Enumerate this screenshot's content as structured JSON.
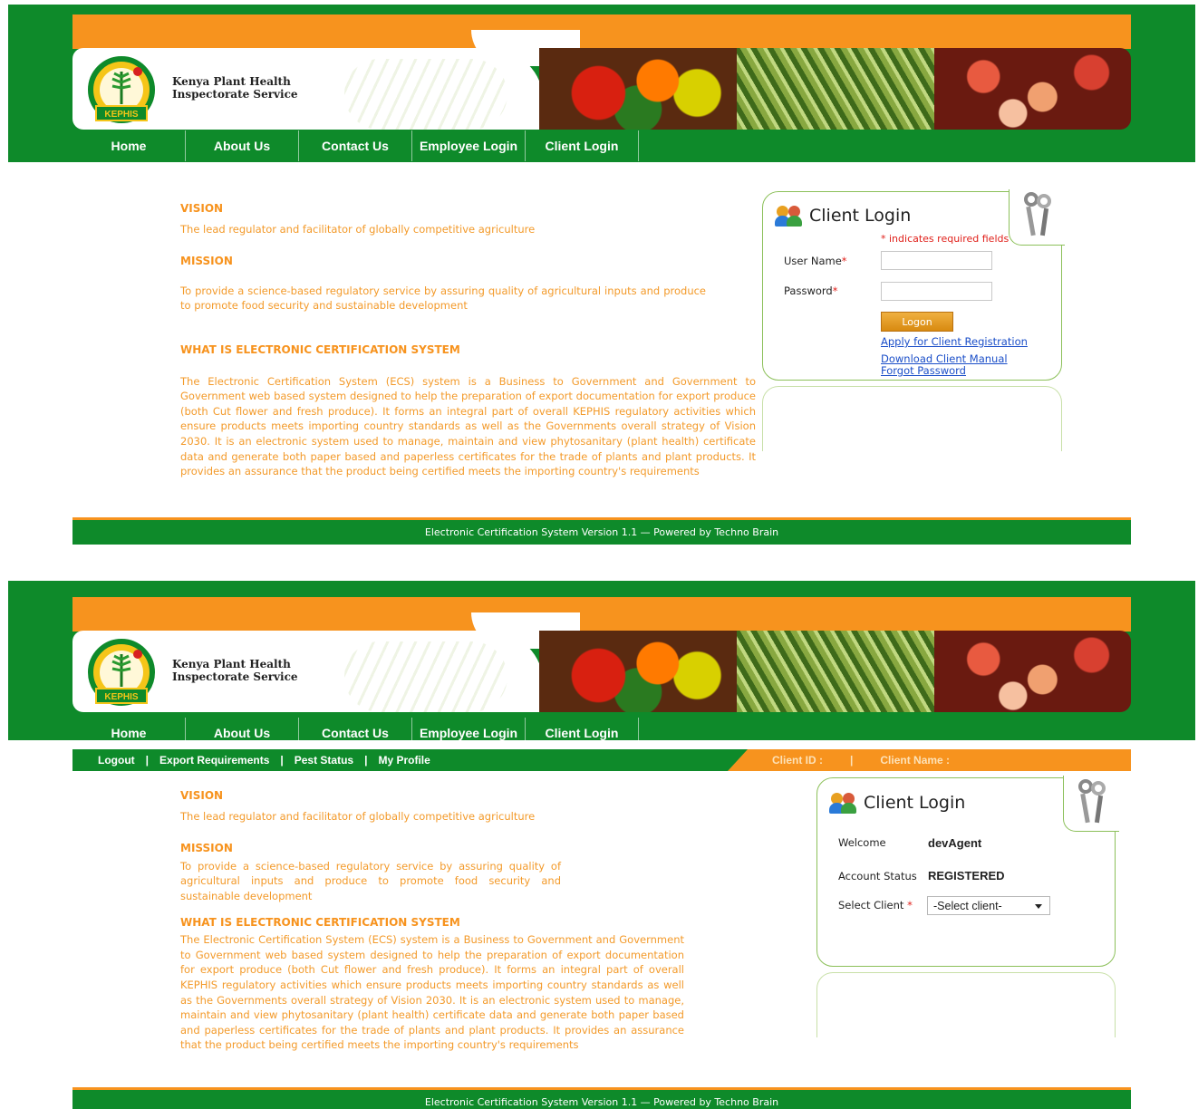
{
  "brand": {
    "line1": "Kenya Plant Health",
    "line2": "Inspectorate Service",
    "logo_text": "KEPHIS"
  },
  "nav": {
    "items": [
      {
        "label": "Home"
      },
      {
        "label": "About Us"
      },
      {
        "label": "Contact Us"
      },
      {
        "label": "Employee Login"
      },
      {
        "label": "Client Login"
      }
    ]
  },
  "content": {
    "vision_heading": "VISION",
    "vision_text": "The lead regulator and facilitator of globally competitive agriculture",
    "mission_heading": "MISSION",
    "mission_text": "To provide a science-based regulatory service by assuring quality of agricultural inputs and produce to promote food security and sustainable development",
    "ecs_heading": "WHAT IS ELECTRONIC CERTIFICATION SYSTEM",
    "ecs_text": "The Electronic Certification System (ECS) system is a Business to Government and Government to Government web based system designed to help the preparation of export documentation for export produce (both Cut flower and fresh produce). It forms an integral part of overall KEPHIS regulatory activities which ensure products meets importing country standards as well as the Governments overall strategy of Vision 2030. It is an electronic system used to manage, maintain and view phytosanitary (plant health) certificate data and generate both paper based and paperless certificates for the trade of plants and plant products. It provides an assurance that the product being certified meets the importing country's requirements"
  },
  "login": {
    "title": "Client Login",
    "required_note": "* indicates required fields",
    "username_label": "User Name",
    "password_label": "Password",
    "required_mark": "*",
    "username_value": "",
    "password_value": "",
    "logon_label": "Logon",
    "apply_link": "Apply for Client Registration",
    "manual_link": "Download Client Manual",
    "forgot_link": "Forgot Password"
  },
  "subnav": {
    "logout": "Logout",
    "export_requirements": "Export Requirements",
    "pest_status": "Pest Status",
    "my_profile": "My Profile",
    "separator": "|",
    "client_id_label": "Client ID :",
    "client_name_label": "Client Name :"
  },
  "welcome_panel": {
    "title": "Client Login",
    "welcome_label": "Welcome",
    "welcome_value": "devAgent",
    "status_label": "Account Status",
    "status_value": "REGISTERED",
    "select_label": "Select Client",
    "select_value": "-Select client-"
  },
  "footer": {
    "text": "Electronic Certification System Version 1.1 — Powered by Techno Brain"
  },
  "colors": {
    "green": "#0e8a2a",
    "orange": "#f7931e",
    "link_blue": "#1a4ec8",
    "required_red": "#e0201a"
  }
}
